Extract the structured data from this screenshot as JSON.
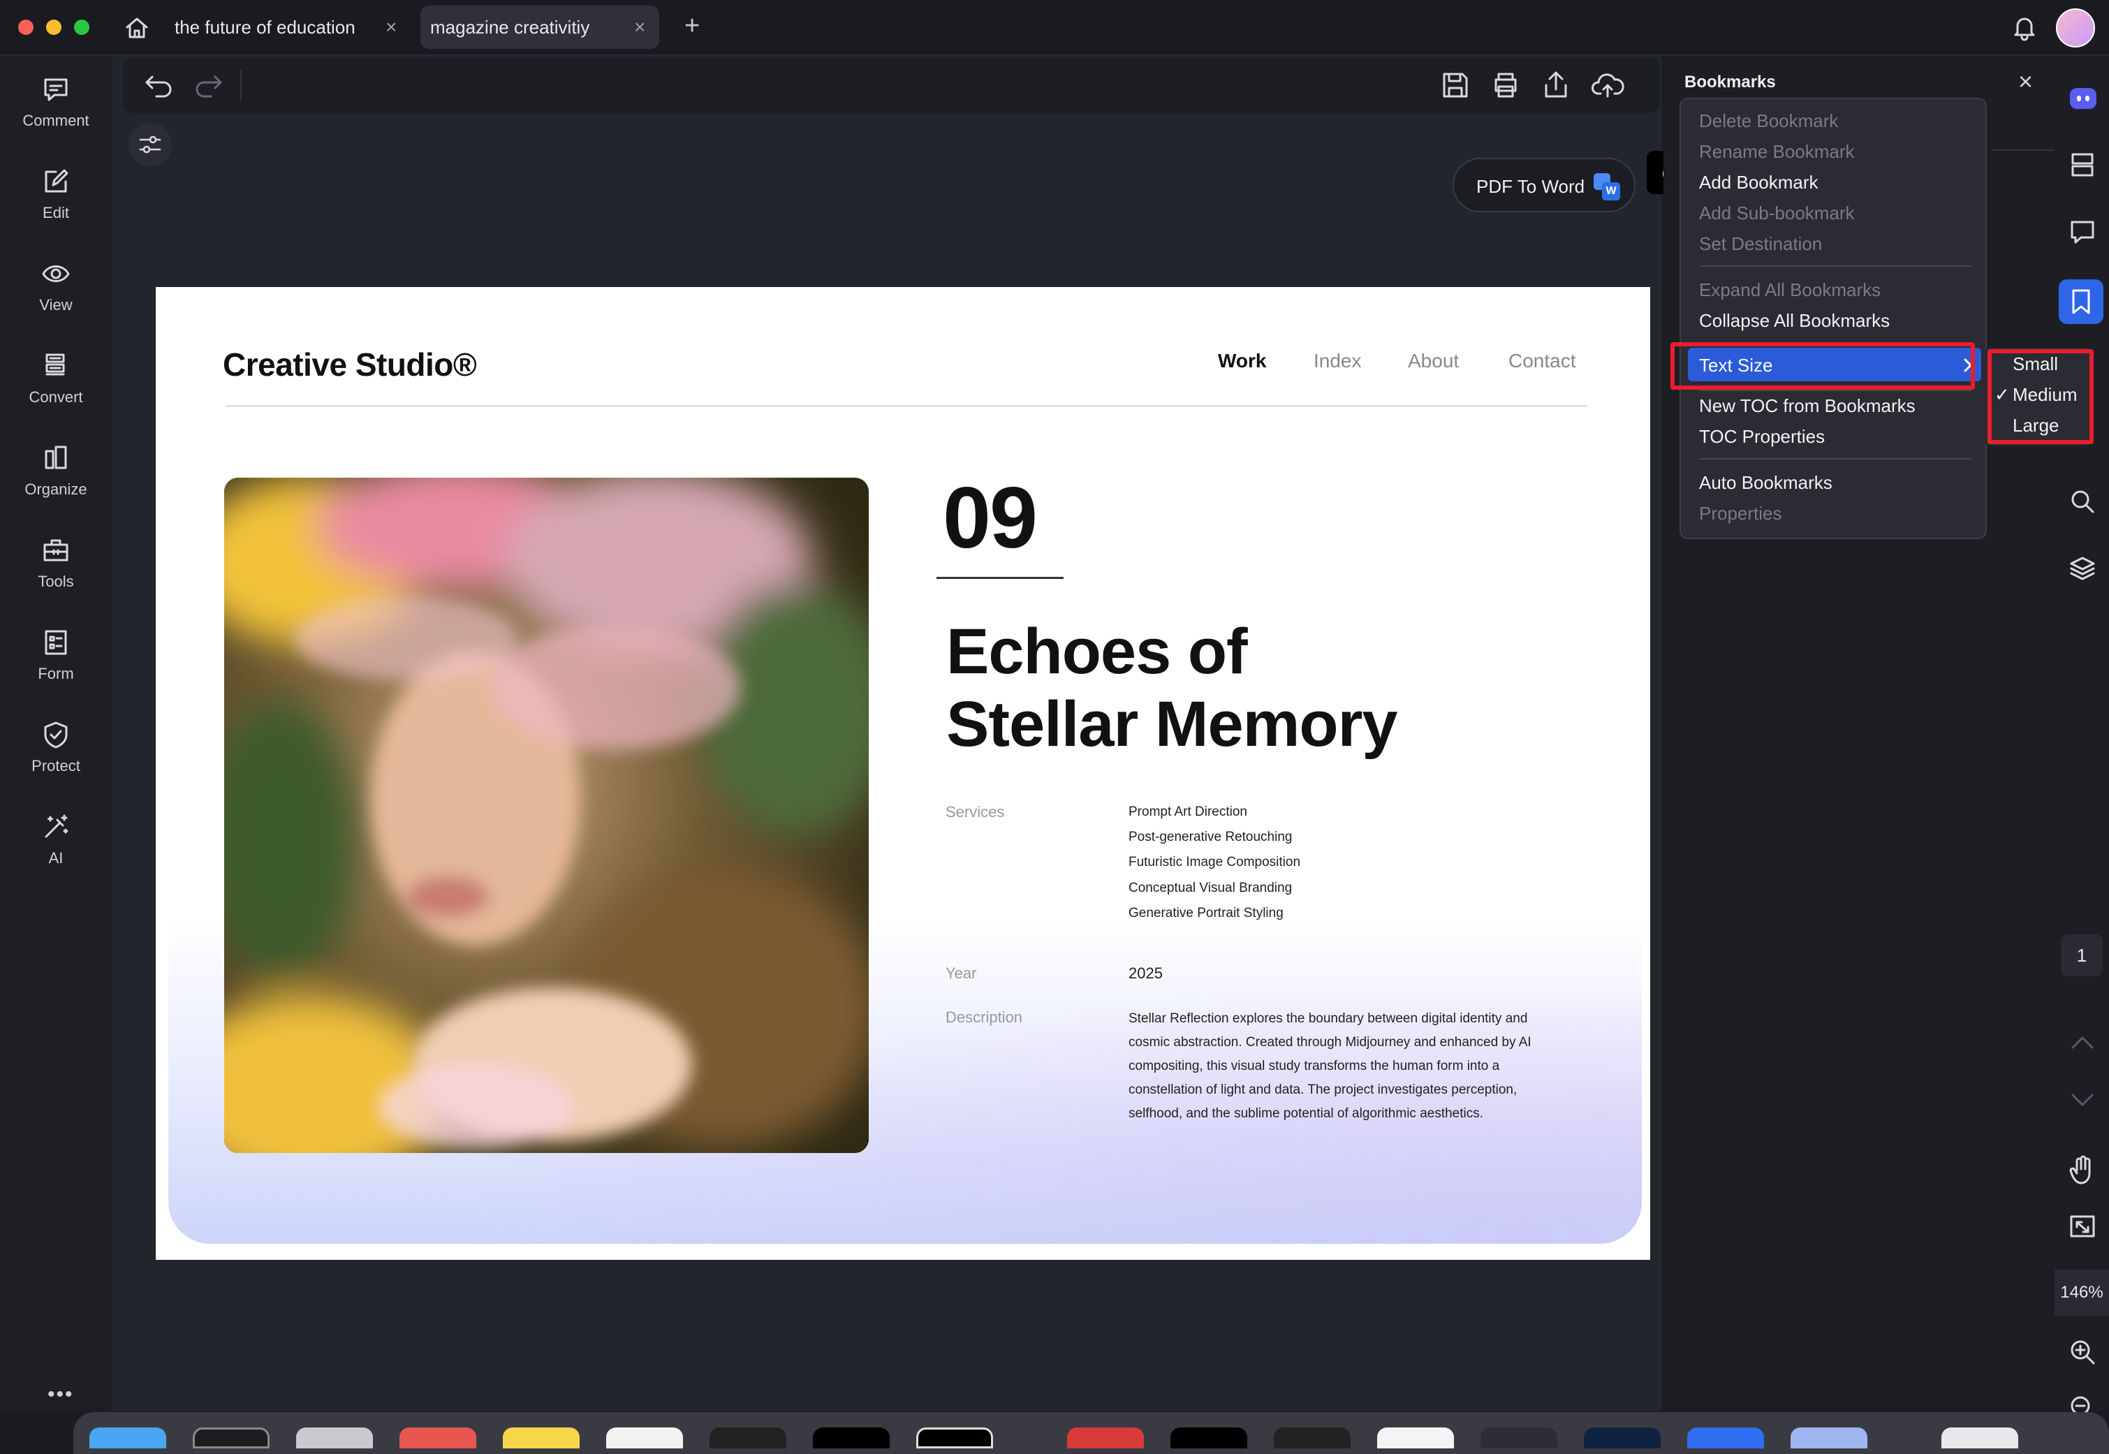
{
  "tabs": [
    {
      "title": "the future of education"
    },
    {
      "title": "magazine creativitiy"
    }
  ],
  "left_tools": [
    "Comment",
    "Edit",
    "View",
    "Convert",
    "Organize",
    "Tools",
    "Form",
    "Protect",
    "AI"
  ],
  "pdf_to_word": "PDF To Word",
  "cut_label": "Op",
  "page": {
    "brand": "Creative Studio®",
    "nav": [
      "Work",
      "Index",
      "About",
      "Contact"
    ],
    "number": "09",
    "title_line1": "Echoes of",
    "title_line2": "Stellar Memory",
    "services_label": "Services",
    "services": [
      "Prompt Art Direction",
      "Post-generative Retouching",
      "Futuristic Image Composition",
      "Conceptual Visual Branding",
      "Generative Portrait Styling"
    ],
    "year_label": "Year",
    "year": "2025",
    "description_label": "Description",
    "description_lines": [
      "Stellar Reflection explores the boundary between digital identity and",
      "cosmic abstraction. Created through Midjourney and enhanced by AI",
      "compositing, this visual study transforms the human form into a",
      "constellation of light and data. The project investigates perception,",
      "selfhood, and the sublime potential of algorithmic aesthetics."
    ]
  },
  "bookmarks": {
    "title": "Bookmarks",
    "menu": {
      "delete": "Delete Bookmark",
      "rename": "Rename Bookmark",
      "add": "Add Bookmark",
      "add_sub": "Add Sub-bookmark",
      "set_dest": "Set Destination",
      "expand": "Expand All Bookmarks",
      "collapse": "Collapse All Bookmarks",
      "text_size": "Text Size",
      "new_toc": "New TOC from Bookmarks",
      "toc_props": "TOC Properties",
      "auto": "Auto Bookmarks",
      "properties": "Properties"
    },
    "submenu": {
      "small": "Small",
      "medium": "Medium",
      "large": "Large",
      "check": "✓"
    }
  },
  "page_number": "1",
  "zoom": "146%",
  "colors": {
    "accent": "#2f5fd8",
    "highlight_outline": "#e81e2c",
    "menu_selected": "#2b5bd7"
  }
}
